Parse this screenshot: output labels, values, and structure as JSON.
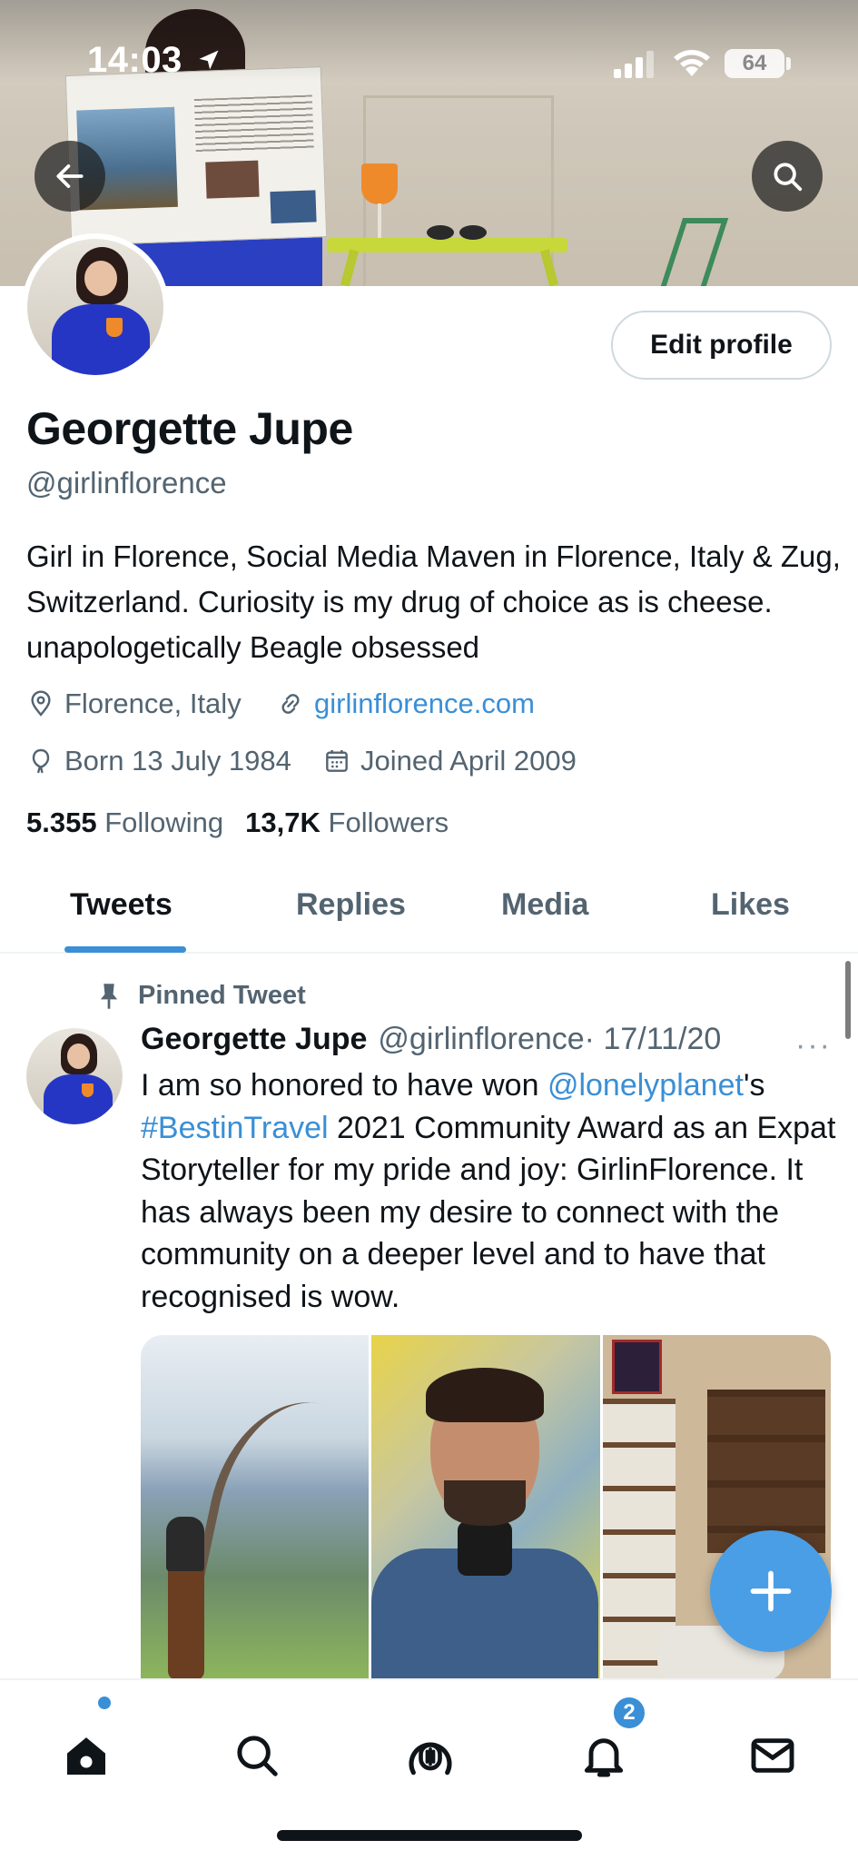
{
  "status_bar": {
    "time": "14:03",
    "battery": "64"
  },
  "profile": {
    "name": "Georgette Jupe",
    "handle": "@girlinflorence",
    "edit_button": "Edit profile",
    "bio": "Girl in Florence, Social Media Maven in Florence, Italy & Zug, Switzerland. Curiosity is my drug of choice as is cheese. unapologetically Beagle obsessed",
    "location": "Florence, Italy",
    "website": "girlinflorence.com",
    "born": "Born 13 July 1984",
    "joined": "Joined April 2009",
    "following_count": "5.355",
    "following_label": "Following",
    "followers_count": "13,7K",
    "followers_label": "Followers"
  },
  "tabs": [
    {
      "label": "Tweets",
      "active": true
    },
    {
      "label": "Replies",
      "active": false
    },
    {
      "label": "Media",
      "active": false
    },
    {
      "label": "Likes",
      "active": false
    }
  ],
  "pinned_tweet": {
    "pinned_label": "Pinned Tweet",
    "author_name": "Georgette Jupe",
    "author_handle": "@girlinflorence",
    "date": "· 17/11/20",
    "more": "···",
    "text_part1": "I am so honored to have won ",
    "mention": "@lonelyplanet",
    "text_part2": "'s ",
    "hashtag": "#BestinTravel",
    "text_part3": " 2021 Community Award as an Expat Storyteller for my pride and joy: GirlinFlorence. It has always been my desire to connect with the community on a deeper level and to have that recognised is wow."
  },
  "bottom_nav": {
    "notifications_badge": "2",
    "items": [
      "home-icon",
      "search-icon",
      "spaces-icon",
      "notifications-icon",
      "messages-icon"
    ]
  },
  "colors": {
    "accent": "#3a8fd6",
    "text_primary": "#0f1419",
    "text_secondary": "#536471"
  }
}
